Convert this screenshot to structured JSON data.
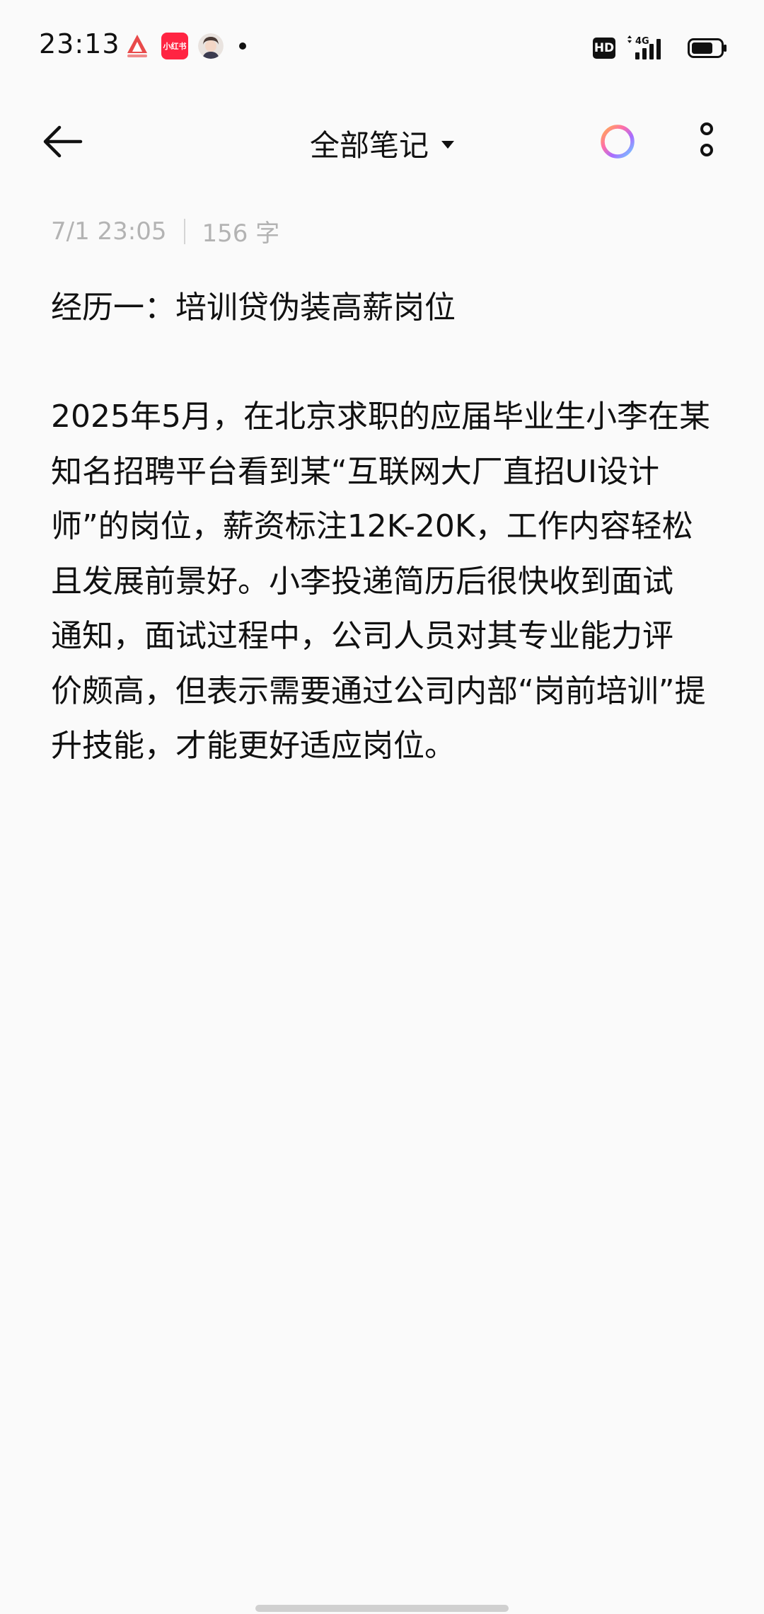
{
  "status_bar": {
    "time": "23:13",
    "notification_icons": [
      "app-a-icon",
      "xiaohongshu-icon",
      "avatar-icon",
      "dot-icon"
    ],
    "xhs_label": "小红书",
    "hd_label": "HD",
    "network_label": "4G",
    "battery_level": 0.75
  },
  "header": {
    "title": "全部笔记"
  },
  "note": {
    "date": "7/1 23:05",
    "word_count": "156 字",
    "title": "经历一：培训贷伪装高薪岗位",
    "body_lines": [
      "2025年5月，在北京求职的应届毕业生小李在某",
      "知名招聘平台看到某“互联网大厂直招UI设计",
      "师”的岗位，薪资标注12K-20K，工作内容轻松",
      "且发展前景好。小李投递简历后很快收到面试",
      "通知，面试过程中，公司人员对其专业能力评",
      "价颇高，但表示需要通过公司内部“岗前培训”提",
      "升技能，才能更好适应岗位。"
    ]
  },
  "colors": {
    "background": "#fafafa",
    "text": "#111111",
    "meta": "#b3b3b3",
    "xhs_brand": "#ff2442"
  }
}
